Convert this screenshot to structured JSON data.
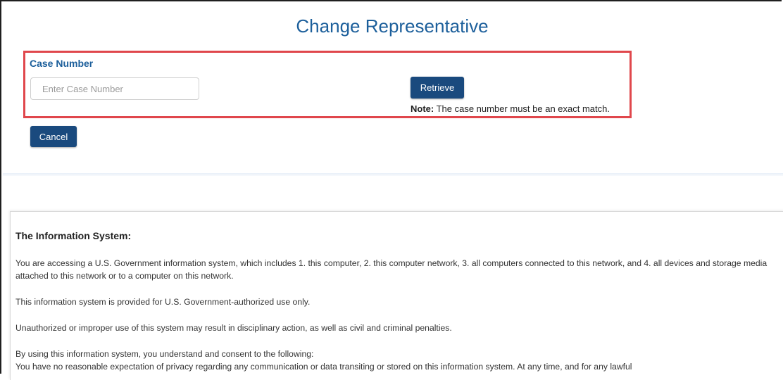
{
  "page": {
    "title": "Change Representative"
  },
  "case_form": {
    "label": "Case Number",
    "input_value": "",
    "input_placeholder": "Enter Case Number",
    "retrieve_label": "Retrieve",
    "note_prefix": "Note:",
    "note_text": " The case number must be an exact match.",
    "cancel_label": "Cancel",
    "highlight_color": "#e0474c",
    "button_color": "#1a4a7e",
    "label_color": "#1c5f9b"
  },
  "info_system": {
    "title": "The Information System:",
    "paragraphs": [
      "You are accessing a U.S. Government information system, which includes 1. this computer, 2. this computer network, 3. all computers connected to this network, and 4. all devices and storage media attached to this network or to a computer on this network.",
      "This information system is provided for U.S. Government-authorized use only.",
      "Unauthorized or improper use of this system may result in disciplinary action, as well as civil and criminal penalties.",
      "By using this information system, you understand and consent to the following:",
      "You have no reasonable expectation of privacy regarding any communication or data transiting or stored on this information system. At any time, and for any lawful"
    ]
  }
}
